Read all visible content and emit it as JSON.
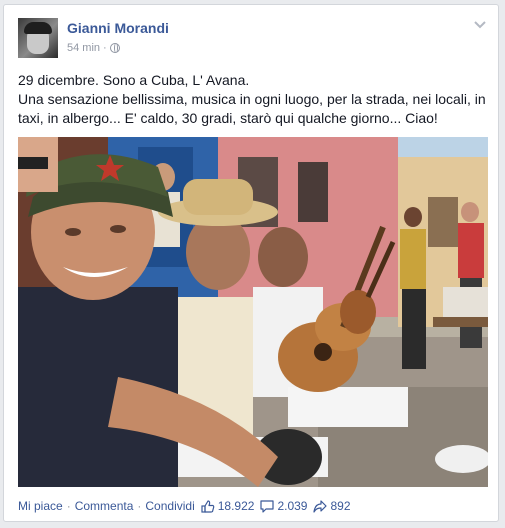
{
  "post": {
    "author": "Gianni Morandi",
    "time": "54 min",
    "separator": "·",
    "text_line1": "29 dicembre. Sono a Cuba, L' Avana.",
    "text_line2": "Una sensazione bellissima, musica in ogni luogo, per la strada, nei locali, in taxi, in albergo... E' caldo, 30 gradi, starò qui qualche giorno... Ciao!",
    "audience_icon": "globe-icon",
    "menu_icon": "chevron-down-icon"
  },
  "actions": {
    "like": "Mi piace",
    "comment": "Commenta",
    "share": "Condividi",
    "separator": "·",
    "likes_count": "18.922",
    "comments_count": "2.039",
    "shares_count": "892"
  },
  "colors": {
    "link": "#3b5998",
    "meta": "#9197a3",
    "text": "#141823",
    "card_bg": "#ffffff",
    "page_bg": "#e9ebee"
  }
}
